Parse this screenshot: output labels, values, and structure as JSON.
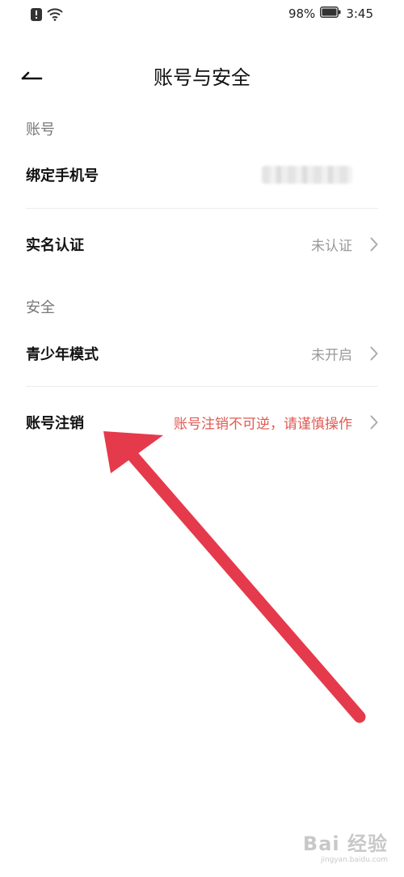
{
  "status_bar": {
    "battery_percent": "98%",
    "time": "3:45"
  },
  "header": {
    "title": "账号与安全"
  },
  "sections": {
    "account_label": "账号",
    "security_label": "安全"
  },
  "rows": {
    "phone": {
      "label": "绑定手机号"
    },
    "real_name": {
      "label": "实名认证",
      "value": "未认证"
    },
    "youth_mode": {
      "label": "青少年模式",
      "value": "未开启"
    },
    "cancel_account": {
      "label": "账号注销",
      "value": "账号注销不可逆，请谨慎操作"
    }
  },
  "watermark": {
    "main": "Bai 经验",
    "sub": "jingyan.baidu.com"
  },
  "colors": {
    "warning_text": "#e05a52",
    "annotation_arrow": "#e53a4b"
  }
}
